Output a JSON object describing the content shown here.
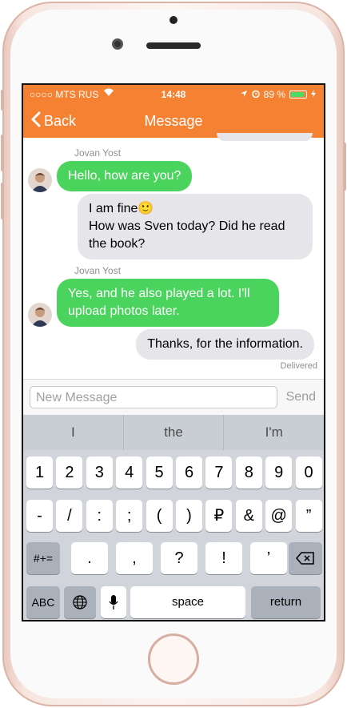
{
  "status_bar": {
    "carrier": "○○○○ MTS RUS",
    "time": "14:48",
    "battery_pct": "89 %",
    "battery_level": 0.89
  },
  "nav": {
    "back_label": "Back",
    "title": "Message"
  },
  "messages": [
    {
      "sender": "Jovan Yost",
      "text": "Hello, how are you?",
      "direction": "incoming"
    },
    {
      "text_line1": "I am fine🙂",
      "text_line2": "How was Sven today? Did he read",
      "text_line3": "the book?",
      "direction": "outgoing"
    },
    {
      "sender": "Jovan Yost",
      "text_line1": "Yes, and he also played a lot. I'll",
      "text_line2": "upload photos later.",
      "direction": "incoming"
    },
    {
      "text": "Thanks, for the information.",
      "direction": "outgoing",
      "status": "Delivered"
    }
  ],
  "composer": {
    "placeholder": "New Message",
    "send_label": "Send"
  },
  "keyboard": {
    "suggestions": [
      "I",
      "the",
      "I'm"
    ],
    "row1": [
      "1",
      "2",
      "3",
      "4",
      "5",
      "6",
      "7",
      "8",
      "9",
      "0"
    ],
    "row2": [
      "-",
      "/",
      ":",
      ";",
      "(",
      ")",
      "₽",
      "&",
      "@",
      "”"
    ],
    "row3": [
      ".",
      ",",
      "?",
      "!",
      "’"
    ],
    "symbols_label": "#+=",
    "abc_label": "ABC",
    "space_label": "space",
    "return_label": "return"
  },
  "colors": {
    "accent": "#f58233",
    "incoming_bubble": "#4ad35d",
    "outgoing_bubble": "#e5e5ea"
  }
}
